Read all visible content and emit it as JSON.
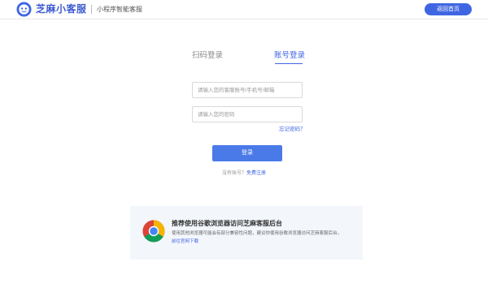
{
  "header": {
    "logo_icon": "bot-face-icon",
    "brand_name": "芝麻小客服",
    "subtitle": "小程序智能客服",
    "home_button": "返回首页",
    "accent_color": "#3f66e2"
  },
  "tabs": [
    {
      "label": "扫码登录",
      "active": false
    },
    {
      "label": "账号登录",
      "active": true
    }
  ],
  "form": {
    "account_placeholder": "请输入您的客服账号/手机号/邮箱",
    "password_placeholder": "请输入您的密码",
    "forgot_label": "忘记密码？",
    "login_label": "登录"
  },
  "register": {
    "prompt": "没有账号？",
    "link": "免费注册"
  },
  "recommend": {
    "icon": "chrome-icon",
    "title": "推荐使用谷歌浏览器访问芝麻客服后台",
    "description": "使用其他浏览器可能会有部分兼容性问题，建议你使用谷歌浏览器访问芝麻客服后台。",
    "link": "前往官网下载"
  }
}
